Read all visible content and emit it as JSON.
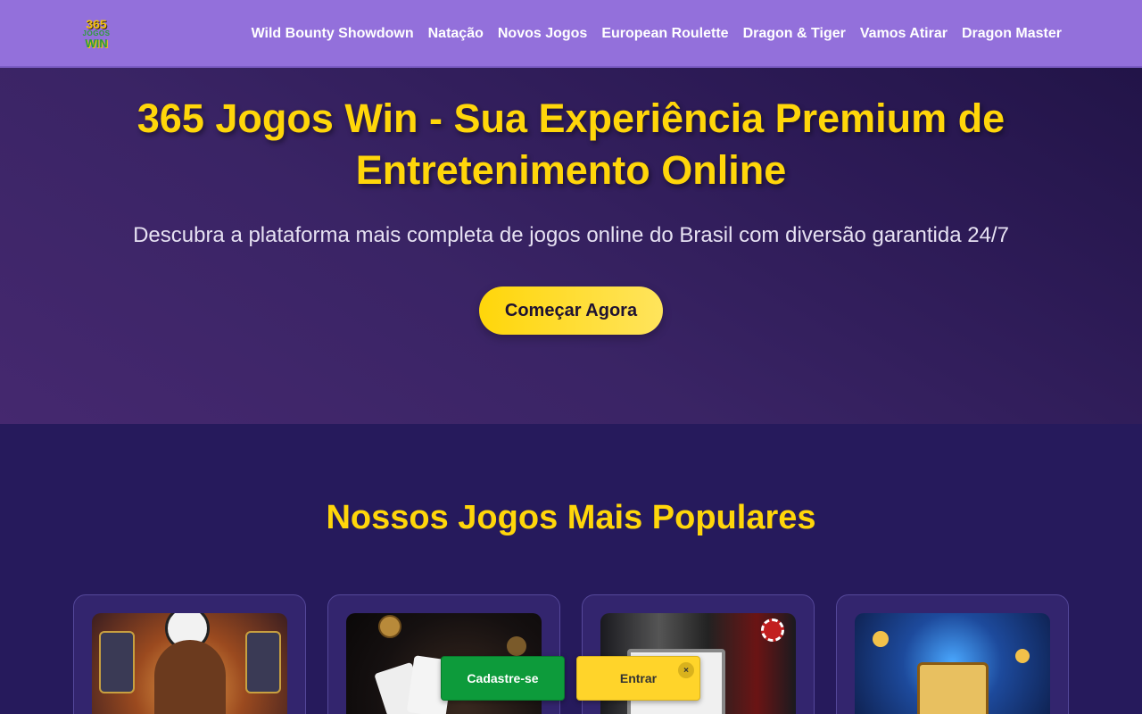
{
  "header": {
    "logo": {
      "line1": "365",
      "line2": "JOGOS",
      "line3": "WIN"
    },
    "nav": [
      "Wild Bounty Showdown",
      "Natação",
      "Novos Jogos",
      "European Roulette",
      "Dragon & Tiger",
      "Vamos Atirar",
      "Dragon Master"
    ]
  },
  "hero": {
    "title": "365 Jogos Win - Sua Experiência Premium de Entretenimento Online",
    "subtitle": "Descubra a plataforma mais completa de jogos online do Brasil com diversão garantida 24/7",
    "cta_label": "Começar Agora"
  },
  "popular": {
    "heading": "Nossos Jogos Mais Populares"
  },
  "floating_bar": {
    "register_label": "Cadastre-se",
    "login_label": "Entrar",
    "close_label": "×"
  },
  "colors": {
    "header_bg": "#9370db",
    "accent_yellow": "#ffd60a",
    "page_bg": "#261a5c",
    "register_green": "#0d9b3b"
  }
}
